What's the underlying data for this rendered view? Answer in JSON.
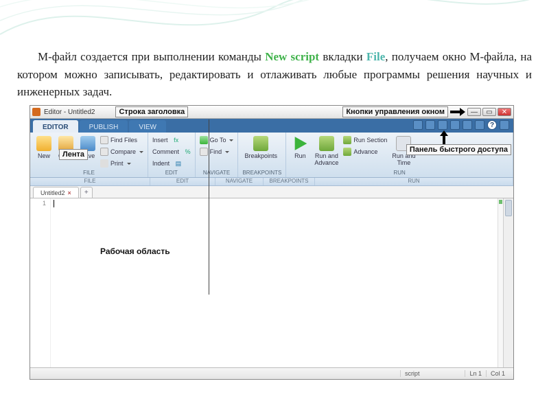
{
  "body_text": {
    "part1": "М-файл создается при выполнении команды ",
    "hl1": "New script",
    "part2": " вкладки ",
    "hl2": "File",
    "part3": ", получаем окно М-файла, на котором можно записывать, редактировать и отлаживать любые программы решения научных и инженерных задач."
  },
  "callouts": {
    "titlebar": "Строка заголовка",
    "winbuttons": "Кнопки управления окном",
    "ribbon": "Лента",
    "qat": "Панель быстрого доступа",
    "workspace": "Рабочая область"
  },
  "window": {
    "title": "Editor - Untitled2"
  },
  "tabs": {
    "editor": "EDITOR",
    "publish": "PUBLISH",
    "view": "VIEW"
  },
  "ribbon": {
    "file": {
      "new": "New",
      "open": "Open",
      "save": "Save",
      "find_files": "Find Files",
      "compare": "Compare",
      "print": "Print",
      "group": "FILE"
    },
    "edit": {
      "insert": "Insert",
      "comment": "Comment",
      "indent": "Indent",
      "group": "EDIT"
    },
    "navigate": {
      "goto": "Go To",
      "find": "Find",
      "group": "NAVIGATE"
    },
    "breakpoints": {
      "breakpoints": "Breakpoints",
      "group": "BREAKPOINTS"
    },
    "run": {
      "run": "Run",
      "run_advance": "Run and\nAdvance",
      "run_section": "Run Section",
      "advance": "Advance",
      "run_time": "Run and\nTime",
      "group": "RUN"
    }
  },
  "doc": {
    "tab": "Untitled2",
    "line1": "1"
  },
  "status": {
    "type": "script",
    "ln": "Ln 1",
    "col": "Col 1"
  }
}
